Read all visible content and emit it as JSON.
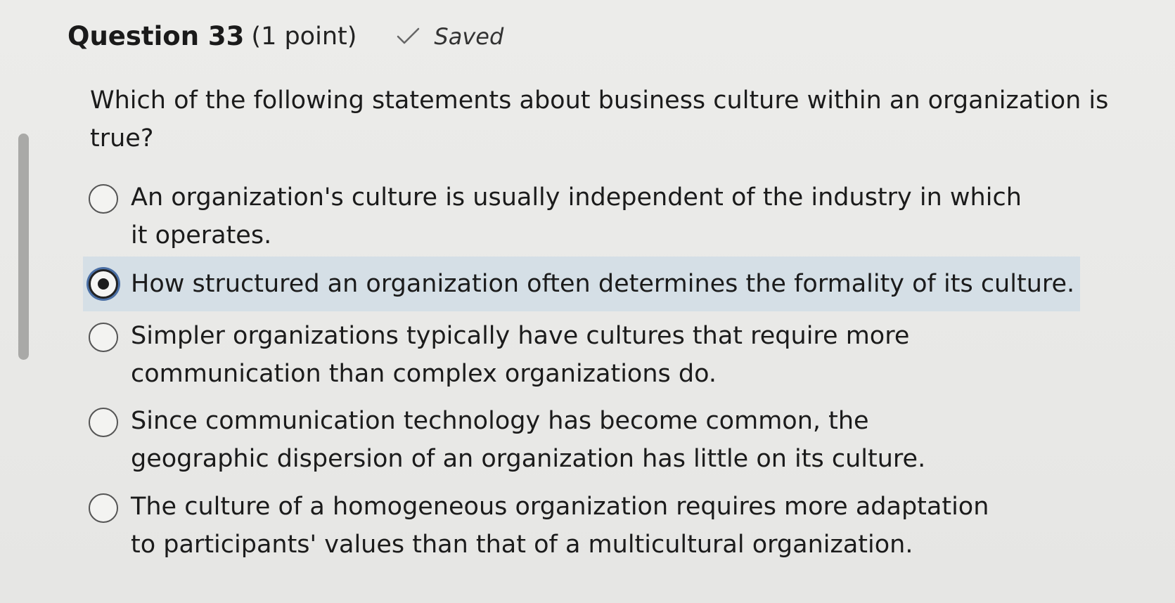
{
  "question": {
    "title": "Question 33",
    "points": "(1 point)",
    "status_icon": "check-icon",
    "status": "Saved",
    "prompt": "Which of the following statements about business culture within an organization is true?"
  },
  "options": [
    {
      "label": "An organization's culture is usually independent of the industry in which it operates.",
      "selected": false
    },
    {
      "label": "How structured an organization often determines the formality of its culture.",
      "selected": true
    },
    {
      "label": "Simpler organizations typically have cultures that require more communication than complex organizations do.",
      "selected": false
    },
    {
      "label": "Since communication technology has become common, the geographic dispersion of an organization has little on its culture.",
      "selected": false
    },
    {
      "label": "The culture of a homogeneous organization requires more adaptation to participants' values than that of a multicultural organization.",
      "selected": false
    }
  ],
  "colors": {
    "background": "#e9e9e7",
    "selected_row": "#d5dfe6",
    "focus_ring": "#4a6fa5",
    "text": "#1b1b1b"
  }
}
